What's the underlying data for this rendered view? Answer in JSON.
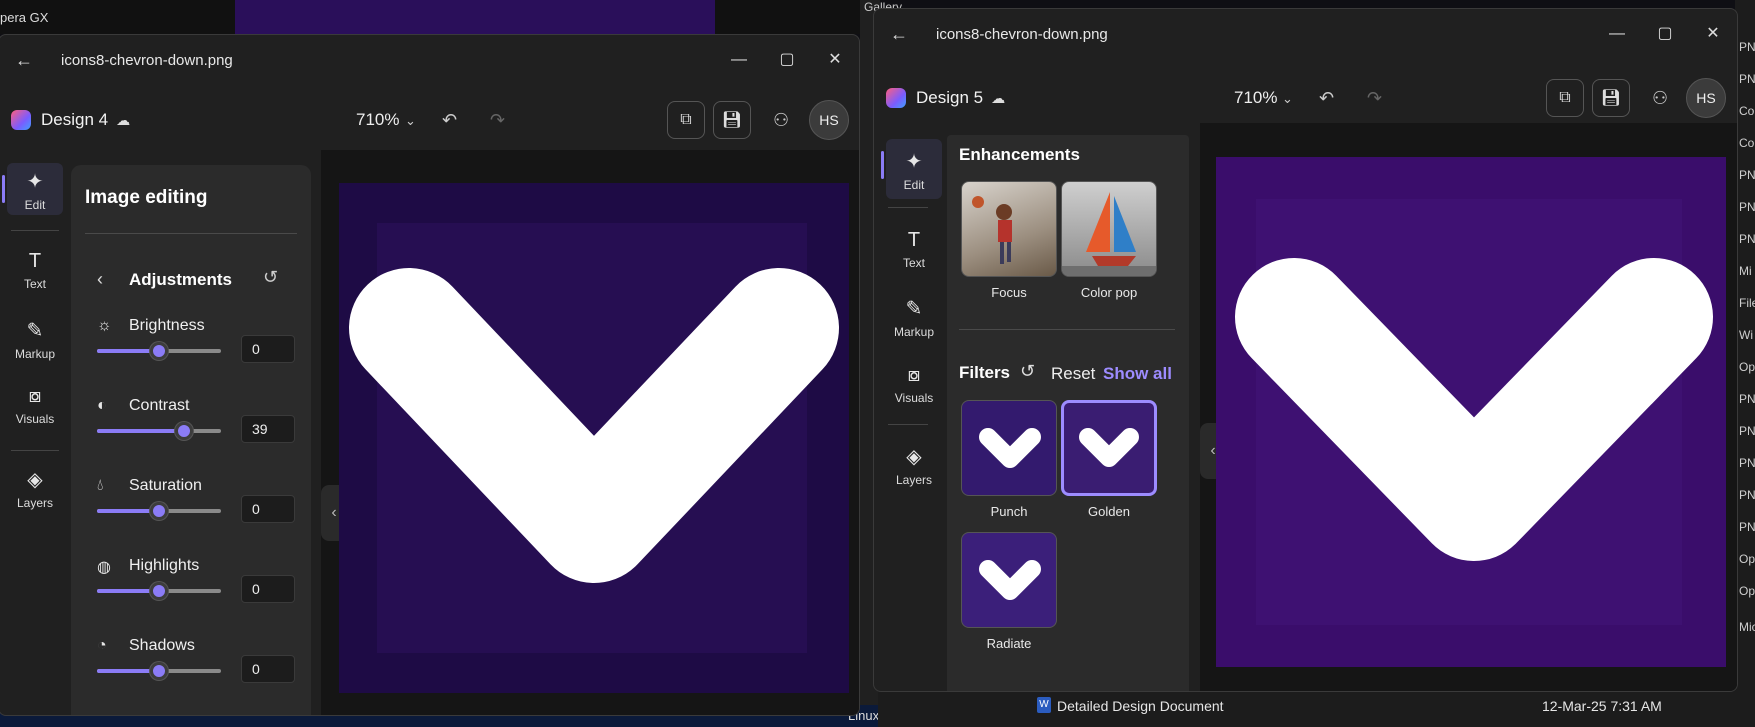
{
  "desktop": {
    "opera_label": "pera GX",
    "gallery_label": "Gallery",
    "linux_label": "Linux",
    "taskbar_doc": "Detailed Design Document",
    "taskbar_time": "12-Mar-25 7:31 AM",
    "right_frags": [
      "PN",
      "PN",
      "Co",
      "Co",
      "PN",
      "PN",
      "PN",
      "Mi",
      "File",
      "Wi",
      "Op",
      "PN",
      "PN",
      "PN",
      "PN",
      "PN",
      "Op",
      "Op",
      "Mic"
    ]
  },
  "window_left": {
    "filename": "icons8-chevron-down.png",
    "design_title": "Design 4",
    "zoom": "710%",
    "avatar": "HS",
    "rail": [
      {
        "label": "Edit",
        "icon": "sparkle-icon"
      },
      {
        "label": "Text",
        "icon": "text-icon"
      },
      {
        "label": "Markup",
        "icon": "markup-icon"
      },
      {
        "label": "Visuals",
        "icon": "visuals-icon"
      },
      {
        "label": "Layers",
        "icon": "layers-icon"
      }
    ],
    "panel": {
      "title": "Image editing",
      "section": "Adjustments",
      "adjustments": [
        {
          "label": "Brightness",
          "value": "0",
          "level": 0.5
        },
        {
          "label": "Contrast",
          "value": "39",
          "level": 0.7
        },
        {
          "label": "Saturation",
          "value": "0",
          "level": 0.5
        },
        {
          "label": "Highlights",
          "value": "0",
          "level": 0.5
        },
        {
          "label": "Shadows",
          "value": "0",
          "level": 0.5
        }
      ]
    }
  },
  "window_right": {
    "filename": "icons8-chevron-down.png",
    "design_title": "Design 5",
    "zoom": "710%",
    "avatar": "HS",
    "rail": [
      {
        "label": "Edit",
        "icon": "sparkle-icon"
      },
      {
        "label": "Text",
        "icon": "text-icon"
      },
      {
        "label": "Markup",
        "icon": "markup-icon"
      },
      {
        "label": "Visuals",
        "icon": "visuals-icon"
      },
      {
        "label": "Layers",
        "icon": "layers-icon"
      }
    ],
    "panel": {
      "enhancements_title": "Enhancements",
      "enhancements": [
        {
          "label": "Focus"
        },
        {
          "label": "Color pop"
        }
      ],
      "filters_title": "Filters",
      "reset_label": "Reset",
      "show_all_label": "Show all",
      "filters": [
        {
          "label": "Punch"
        },
        {
          "label": "Golden"
        },
        {
          "label": "Radiate"
        }
      ]
    }
  },
  "colors": {
    "accent": "#8b7cf6",
    "canvas_purple_left": "#1e0b45",
    "canvas_purple_right": "#3a0d6b"
  }
}
